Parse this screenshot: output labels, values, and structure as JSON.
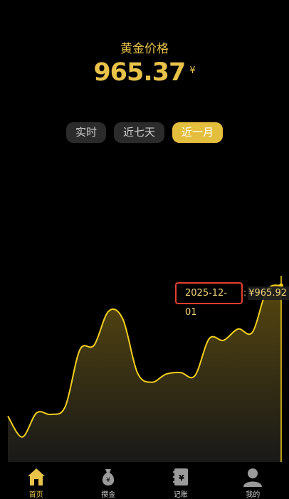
{
  "header": {
    "title": "黄金价格",
    "price": "965.37",
    "currency": "¥"
  },
  "tabs": [
    {
      "label": "实时",
      "active": false
    },
    {
      "label": "近七天",
      "active": false
    },
    {
      "label": "近一月",
      "active": true
    }
  ],
  "tooltip": {
    "date": "2025-12-01",
    "separator": ":",
    "value": "¥965.92"
  },
  "nav": [
    {
      "label": "首页",
      "icon": "home-icon",
      "active": true
    },
    {
      "label": "攒金",
      "icon": "money-bag-icon",
      "active": false
    },
    {
      "label": "记账",
      "icon": "ledger-icon",
      "active": false
    },
    {
      "label": "我的",
      "icon": "user-icon",
      "active": false
    }
  ],
  "colors": {
    "accent": "#e9c24a",
    "line": "#f4cf1e",
    "highlight": "#e2402f"
  },
  "chart_data": {
    "type": "area",
    "series": [
      {
        "values": [
          885,
          872,
          887,
          886,
          891,
          926,
          929,
          950,
          945,
          912,
          906,
          911,
          912,
          910,
          933,
          932,
          939,
          937,
          963,
          966
        ]
      }
    ]
  }
}
